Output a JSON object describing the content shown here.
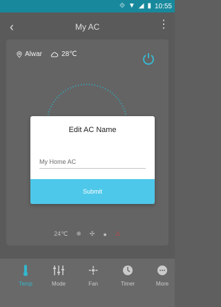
{
  "status": {
    "time": "10:55"
  },
  "appbar": {
    "title": "My AC"
  },
  "location": {
    "city": "Alwar",
    "temp": "28℃"
  },
  "footer_row": {
    "setpoint": "24℃"
  },
  "dialog": {
    "title": "Edit AC Name",
    "input_value": "My Home AC",
    "submit_label": "Submit"
  },
  "tabs": [
    {
      "label": "Temp",
      "icon": "thermometer-icon",
      "active": true
    },
    {
      "label": "Mode",
      "icon": "sliders-icon",
      "active": false
    },
    {
      "label": "Fan",
      "icon": "fan-icon",
      "active": false
    },
    {
      "label": "Timer",
      "icon": "timer-icon",
      "active": false
    },
    {
      "label": "More",
      "icon": "more-icon",
      "active": false
    }
  ],
  "colors": {
    "statusbar": "#18899c",
    "accent": "#36c2d9",
    "submit": "#4ec8ea",
    "warning": "#e04747"
  }
}
